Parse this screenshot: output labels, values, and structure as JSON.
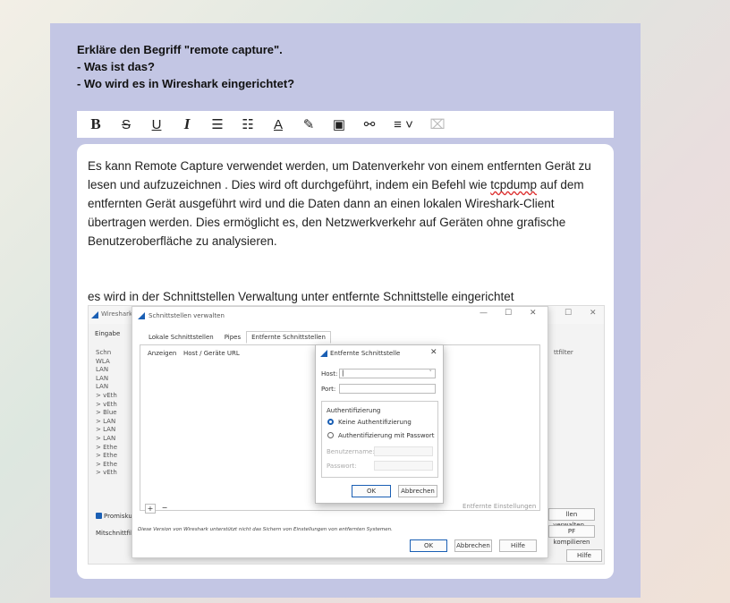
{
  "prompt": {
    "line1": "Erkläre den Begriff \"remote capture\".",
    "line2": "- Was ist das?",
    "line3": "- Wo wird es in Wireshark eingerichtet?"
  },
  "toolbar": {
    "bold": "B",
    "strike": "S",
    "underline": "U",
    "italic": "I",
    "bullet_list": "☰",
    "numbered_list": "☷",
    "text_color": "A",
    "highlight": "✎",
    "image": "▣",
    "link": "⚯",
    "align": "≡ ˅",
    "clear": "⌧"
  },
  "editor": {
    "p1_before": "Es kann Remote Capture verwendet werden, um Datenverkehr von einem entfernten Gerät zu lesen und aufzuzeichnen . Dies wird oft durchgeführt, indem ein Befehl wie ",
    "p1_spell": "tcpdump",
    "p1_after": " auf dem entfernten Gerät ausgeführt wird und die Daten dann an einen lokalen Wireshark-Client übertragen werden. Dies ermöglicht es, den Netzwerkverkehr auf Geräten ohne grafische Benutzeroberfläche zu analysieren.",
    "p2": "es wird in der Schnittstellen Verwaltung unter entfernte Schnittstelle eingerichtet"
  },
  "screenshot": {
    "bg_title": "Wireshark ·",
    "eingabe": "Eingabe",
    "left_list": [
      "Schn",
      "WLA",
      "LAN",
      "LAN",
      "LAN",
      "> vEth",
      "> vEth",
      "> Blue",
      "> LAN",
      "> LAN",
      "> LAN",
      "> Ethe",
      "> Ethe",
      "> Ethe",
      "> vEth"
    ],
    "promisc": "Promisku",
    "mitschnitt": "Mitschnittfilt",
    "right_filter": "ttfilter",
    "right_verwalten": "llen verwalten...",
    "right_bpf": "PF kompilieren",
    "right_hilfe": "Hilfe",
    "dialog": {
      "title": "Schnittstellen verwalten",
      "tabs": [
        "Lokale Schnittstellen",
        "Pipes",
        "Entfernte Schnittstellen"
      ],
      "col_show": "Anzeigen",
      "col_host": "Host / Geräte URL",
      "plus": "+",
      "minus": "−",
      "remote_settings": "Entfernte Einstellungen",
      "note": "Diese Version von Wireshark unterstützt nicht das Sichern von Einstellungen von entfernten Systemen.",
      "ok": "OK",
      "discard": "Abbrechen",
      "help": "Hilfe"
    },
    "inner": {
      "title": "Entfernte Schnittstelle",
      "host_label": "Host:",
      "port_label": "Port:",
      "auth_label": "Authentifizierung",
      "no_auth": "Keine Authentifizierung",
      "pw_auth": "Authentifizierung mit Passwort",
      "user_label": "Benutzername:",
      "pw_label": "Passwort:",
      "ok": "OK",
      "cancel": "Abbrechen"
    }
  }
}
